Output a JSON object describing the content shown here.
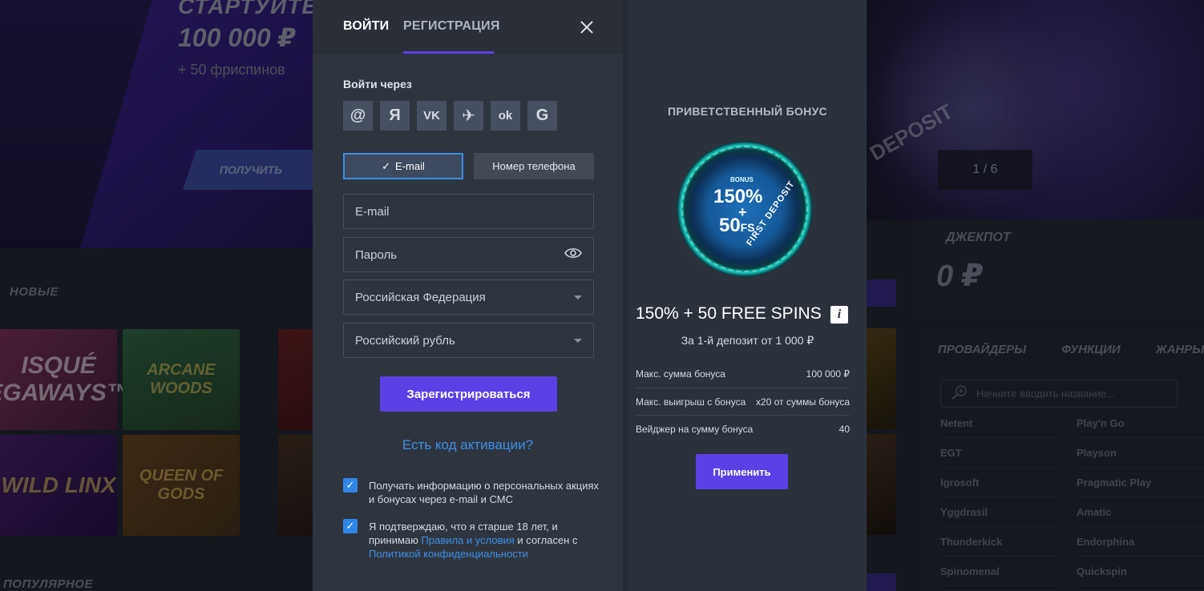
{
  "background": {
    "hero": {
      "title": "СТАРТУЙТЕ",
      "amount": "100 000 ₽",
      "sub": "+ 50 фриспинов",
      "cta": "ПОЛУЧИТЬ"
    },
    "slider_counter": "1 / 6",
    "jackpot": {
      "label": "ДЖЕКПОТ",
      "value": "0 ₽"
    },
    "sections": {
      "new": "НОВЫЕ",
      "popular": "ПОПУЛЯРНОЕ"
    },
    "games": [
      "ISQUÉ EGAWAYS™",
      "ARCANE WOODS",
      "",
      "WILD LINX",
      "QUEEN OF GODS",
      ""
    ],
    "providers": {
      "tabs": [
        "ПРОВАЙДЕРЫ",
        "ФУНКЦИИ",
        "ЖАНРЫ"
      ],
      "search_placeholder": "Начните вводить название...",
      "left": [
        "Netent",
        "EGT",
        "Igrosoft",
        "Yggdrasil",
        "Thunderkick",
        "Spinomenal"
      ],
      "right": [
        "Play'n Go",
        "Playson",
        "Pragmatic Play",
        "Amatic",
        "Endorphina",
        "Quickspin"
      ]
    },
    "right_hero_text": "DEPOSIT"
  },
  "modal": {
    "tabs": {
      "login": "ВОЙТИ",
      "register": "РЕГИСТРАЦИЯ"
    },
    "login_via": "Войти через",
    "socials": [
      "@",
      "Я",
      "VK",
      "✈",
      "ok",
      "G"
    ],
    "mode": {
      "email": "E-mail",
      "phone": "Номер телефона",
      "check": "✓"
    },
    "fields": {
      "email": "E-mail",
      "password": "Пароль",
      "country": "Российская Федерация",
      "currency": "Российский рубль"
    },
    "submit": "Зарегистрироваться",
    "activation_link": "Есть код активации?",
    "consent1": "Получать информацию о персональных акциях и бонусах через e-mail и СМС",
    "consent2": {
      "prefix": "Я подтверждаю, что я старше 18 лет, и принимаю ",
      "rules": "Правила и условия",
      "middle": " и согласен с ",
      "privacy": "Политикой конфиденциальности"
    },
    "checkbox_mark": "✓"
  },
  "bonus": {
    "heading": "ПРИВЕТСТВЕННЫЙ БОНУС",
    "disc": {
      "small": "BONUS",
      "line1": "150%",
      "plus": "+",
      "line2": "50",
      "fs": "FS",
      "arc": "FIRST DEPOSIT"
    },
    "title": "150% + 50 FREE SPINS",
    "info": "i",
    "subtitle": "За 1-й депозит от 1 000 ₽",
    "terms": [
      {
        "label": "Макс. сумма бонуса",
        "value": "100 000 ₽"
      },
      {
        "label": "Макс. выигрыш с бонуса",
        "value": "x20 от суммы бонуса"
      },
      {
        "label": "Вейджер на сумму бонуса",
        "value": "40"
      }
    ],
    "apply": "Применить"
  }
}
